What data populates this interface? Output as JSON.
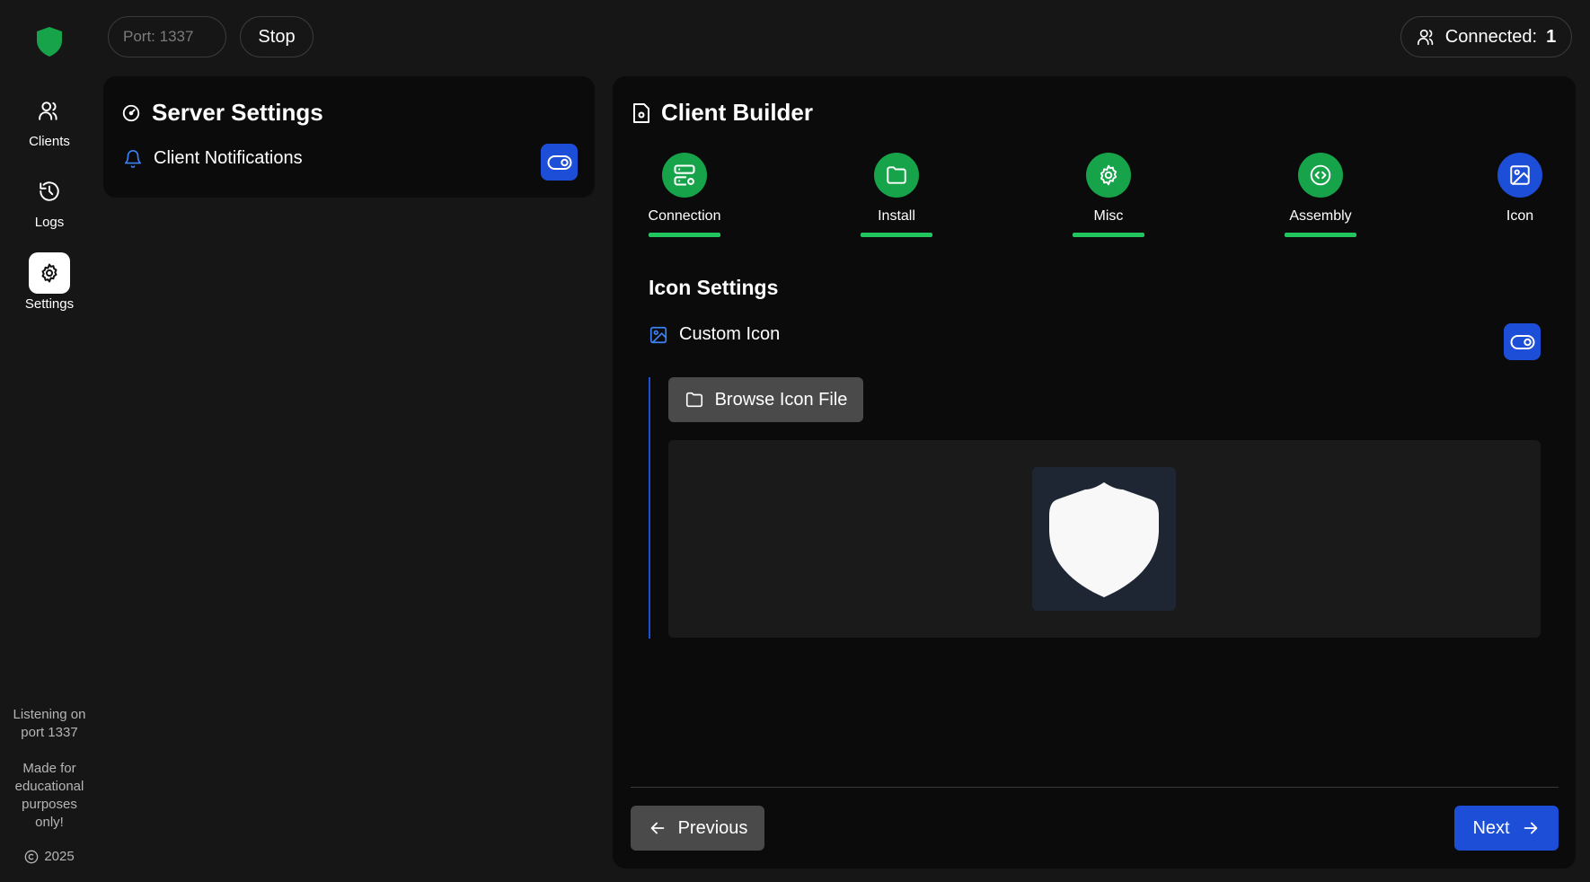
{
  "app": {
    "logo_icon": "shield-icon",
    "accent_color": "#1d4ed8",
    "success_color": "#16a34a"
  },
  "sidebar": {
    "items": [
      {
        "label": "Clients",
        "icon": "users-icon",
        "active": false
      },
      {
        "label": "Logs",
        "icon": "history-icon",
        "active": false
      },
      {
        "label": "Settings",
        "icon": "gear-icon",
        "active": true
      }
    ],
    "status_text": "Listening on port 1337",
    "disclaimer": "Made for educational purposes only!",
    "copyright_year": "2025"
  },
  "topbar": {
    "port_placeholder": "Port: 1337",
    "port_value": "",
    "stop_label": "Stop",
    "connected_label": "Connected:",
    "connected_count": "1"
  },
  "server_settings": {
    "title": "Server Settings",
    "client_notifications_label": "Client Notifications",
    "client_notifications_enabled": true
  },
  "client_builder": {
    "title": "Client Builder",
    "steps": [
      {
        "label": "Connection",
        "icon": "server-gear-icon",
        "state": "done"
      },
      {
        "label": "Install",
        "icon": "folder-icon",
        "state": "done"
      },
      {
        "label": "Misc",
        "icon": "gear-icon",
        "state": "done"
      },
      {
        "label": "Assembly",
        "icon": "code-icon",
        "state": "done"
      },
      {
        "label": "Icon",
        "icon": "image-icon",
        "state": "current"
      }
    ],
    "section_title": "Icon Settings",
    "custom_icon_label": "Custom Icon",
    "custom_icon_enabled": true,
    "browse_label": "Browse Icon File",
    "previous_label": "Previous",
    "next_label": "Next"
  }
}
